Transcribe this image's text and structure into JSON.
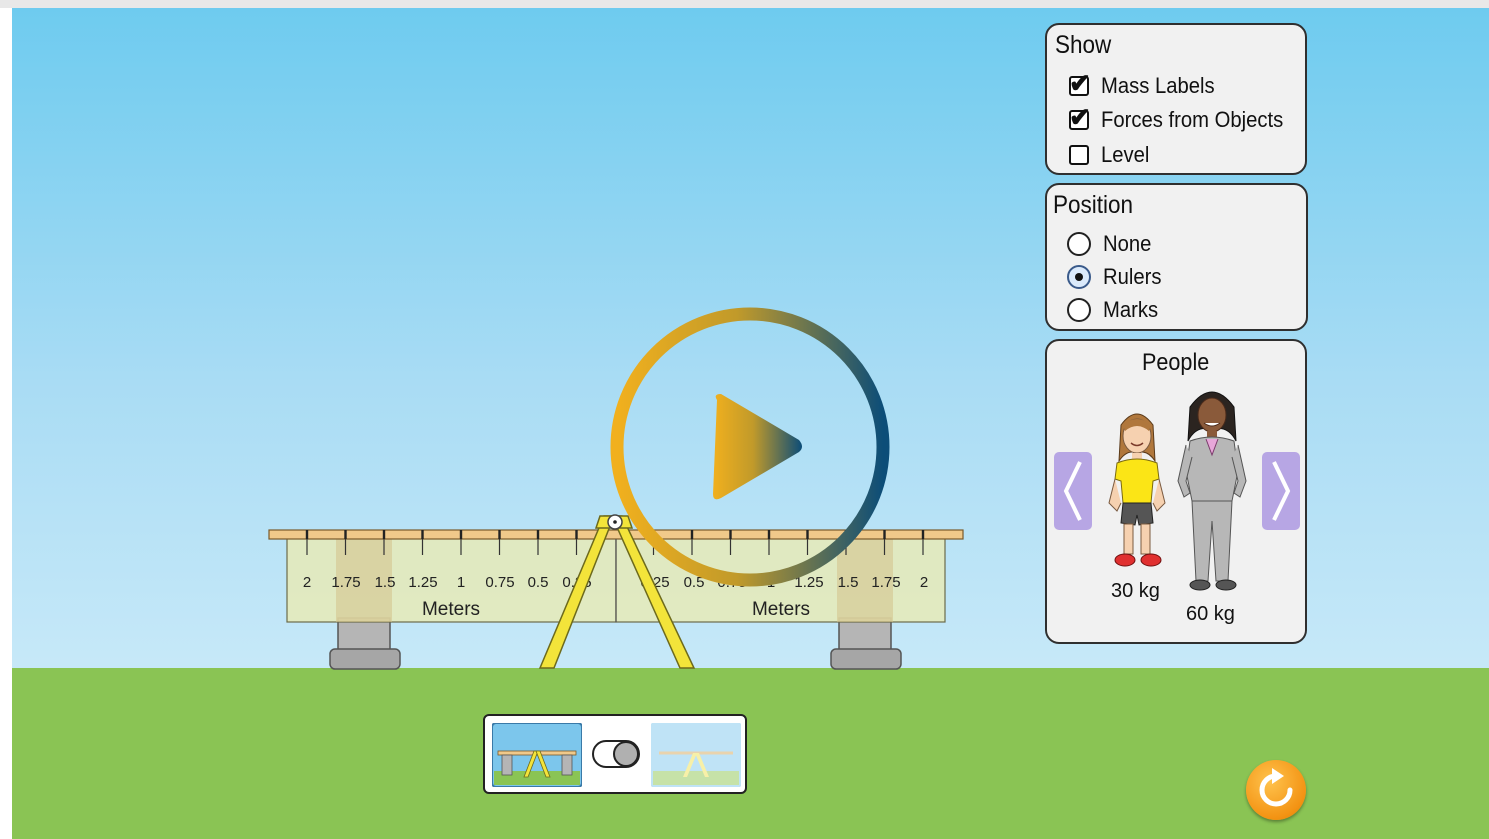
{
  "show_panel": {
    "title": "Show",
    "items": [
      {
        "label": "Mass Labels",
        "checked": true
      },
      {
        "label": "Forces from Objects",
        "checked": true
      },
      {
        "label": "Level",
        "checked": false
      }
    ]
  },
  "position_panel": {
    "title": "Position",
    "options": [
      {
        "label": "None",
        "selected": false
      },
      {
        "label": "Rulers",
        "selected": true
      },
      {
        "label": "Marks",
        "selected": false
      }
    ]
  },
  "people_panel": {
    "title": "People",
    "people": [
      {
        "name": "girl",
        "mass_label": "30 kg"
      },
      {
        "name": "woman",
        "mass_label": "60 kg"
      }
    ]
  },
  "ruler": {
    "left_ticks": [
      "2",
      "1.75",
      "1.5",
      "1.25",
      "1",
      "0.75",
      "0.5",
      "0.25"
    ],
    "right_ticks": [
      "0.25",
      "0.5",
      "0.75",
      "1",
      "1.25",
      "1.5",
      "1.75",
      "2"
    ],
    "left_unit": "Meters",
    "right_unit": "Meters"
  },
  "bottom_toggle": {
    "state": "supports-on"
  },
  "colors": {
    "sky_top": "#6ecbef",
    "ground": "#8ac454",
    "plank": "#f0c98a",
    "ruler_fill": "#e6eab7",
    "stand": "#f3e43a",
    "nav_button": "#b7a6e4",
    "reset": "#f39313"
  },
  "icons": {
    "play": "play-icon",
    "reset": "reset-icon",
    "prev": "chevron-left-icon",
    "next": "chevron-right-icon"
  }
}
